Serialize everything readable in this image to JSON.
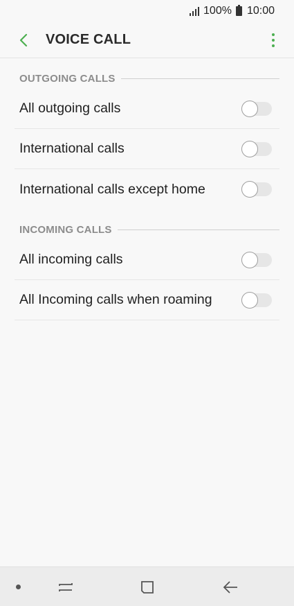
{
  "status_bar": {
    "battery": "100%",
    "time": "10:00"
  },
  "header": {
    "title": "VOICE CALL"
  },
  "sections": [
    {
      "title": "OUTGOING CALLS",
      "items": [
        {
          "label": "All outgoing calls",
          "enabled": false
        },
        {
          "label": "International calls",
          "enabled": false
        },
        {
          "label": "International calls except home",
          "enabled": false
        }
      ]
    },
    {
      "title": "INCOMING CALLS",
      "items": [
        {
          "label": "All incoming calls",
          "enabled": false
        },
        {
          "label": "All Incoming calls when roaming",
          "enabled": false
        }
      ]
    }
  ],
  "colors": {
    "accent": "#4caf50"
  },
  "icons": {
    "back": "chevron-left-icon",
    "more": "more-vertical-icon",
    "recents": "recent-apps-icon",
    "home": "home-icon",
    "nav_back": "back-arrow-icon"
  }
}
